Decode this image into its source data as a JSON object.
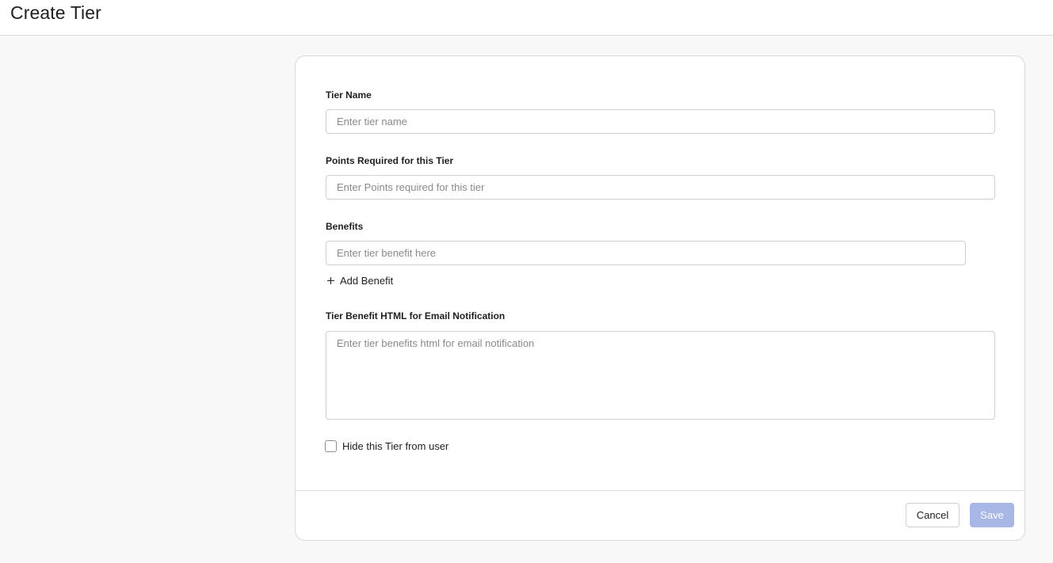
{
  "header": {
    "title": "Create Tier"
  },
  "form": {
    "tier_name": {
      "label": "Tier Name",
      "placeholder": "Enter tier name",
      "value": ""
    },
    "points": {
      "label": "Points Required for this Tier",
      "placeholder": "Enter Points required for this tier",
      "value": ""
    },
    "benefits": {
      "label": "Benefits",
      "items": [
        {
          "placeholder": "Enter tier benefit here",
          "value": ""
        }
      ],
      "add_label": "Add Benefit"
    },
    "email_html": {
      "label": "Tier Benefit HTML for Email Notification",
      "placeholder": "Enter tier benefits html for email notification",
      "value": ""
    },
    "hide_tier": {
      "label": "Hide this Tier from user",
      "checked": false
    }
  },
  "footer": {
    "cancel_label": "Cancel",
    "save_label": "Save"
  },
  "colors": {
    "save_button": "#a9b7e6",
    "background": "#f8f8f8"
  },
  "icons": {
    "add_benefit": "plus-icon"
  }
}
